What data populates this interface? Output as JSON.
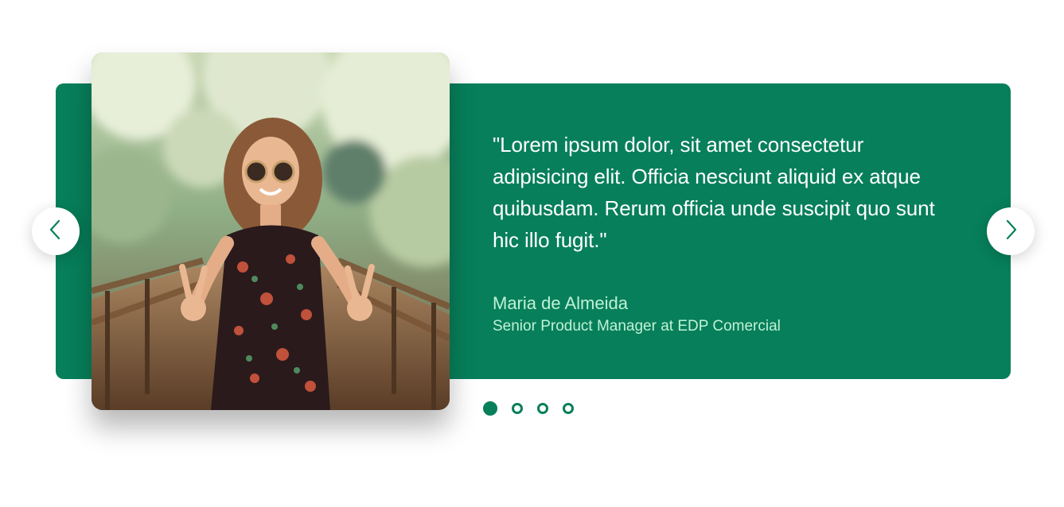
{
  "testimonial": {
    "quote": "\"Lorem ipsum dolor, sit amet consectetur adipisicing elit. Officia nesciunt aliquid ex atque quibusdam. Rerum officia unde suscipit quo sunt hic illo fugit.\"",
    "author_name": "Maria de Almeida",
    "author_role": "Senior Product Manager at EDP Comercial"
  },
  "carousel": {
    "slide_count": 4,
    "active_slide": 1,
    "prev_icon": "chevron-left-icon",
    "next_icon": "chevron-right-icon"
  },
  "colors": {
    "accent": "#077f5a",
    "author_text": "#bff2d6",
    "quote_text": "#ffffff"
  }
}
